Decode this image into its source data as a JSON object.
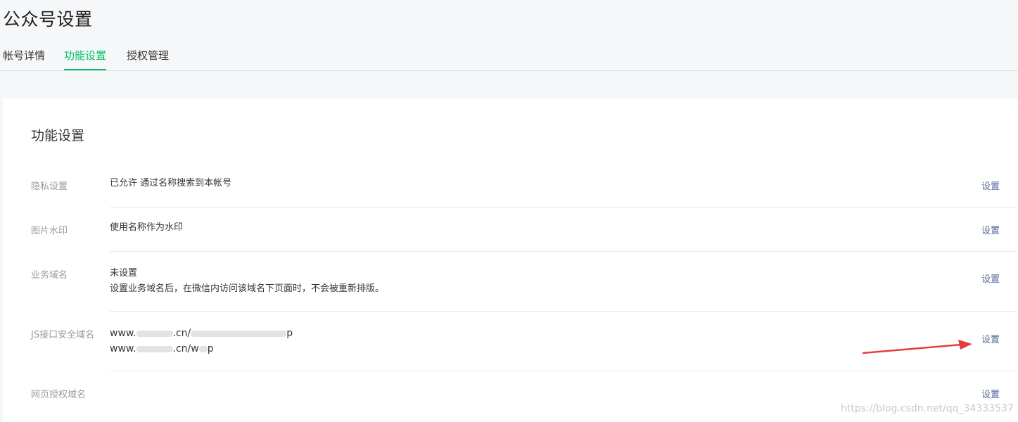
{
  "page_title": "公众号设置",
  "tabs": [
    {
      "label": "帐号详情",
      "active": false
    },
    {
      "label": "功能设置",
      "active": true
    },
    {
      "label": "授权管理",
      "active": false
    }
  ],
  "card_title": "功能设置",
  "rows": [
    {
      "label": "隐私设置",
      "value_lines": [
        "已允许 通过名称搜索到本帐号"
      ],
      "action": "设置"
    },
    {
      "label": "图片水印",
      "value_lines": [
        "使用名称作为水印"
      ],
      "action": "设置"
    },
    {
      "label": "业务域名",
      "value_lines": [
        "未设置",
        "设置业务域名后，在微信内访问该域名下页面时，不会被重新排版。"
      ],
      "action": "设置"
    },
    {
      "label": "JS接口安全域名",
      "value_lines": [
        "www.",
        ".cn/",
        "p",
        "www.",
        ".cn/w",
        "p"
      ],
      "action": "设置"
    },
    {
      "label": "网页授权域名",
      "value_lines": [],
      "action": "设置"
    }
  ],
  "watermark": "https://blog.csdn.net/qq_34333537",
  "colors": {
    "accent": "#07c160",
    "link": "#576b95",
    "arrow": "#e83c3c"
  }
}
